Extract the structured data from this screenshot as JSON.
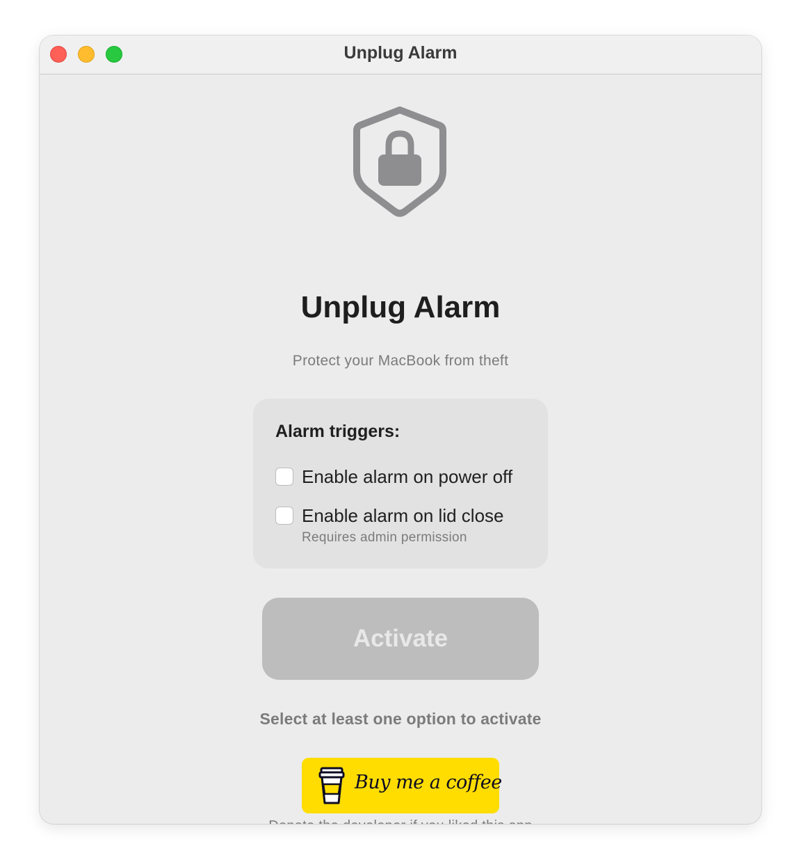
{
  "window": {
    "title": "Unplug Alarm"
  },
  "header": {
    "icon": "shield-lock-icon",
    "app_title": "Unplug Alarm",
    "subtitle": "Protect your MacBook from theft"
  },
  "triggers": {
    "heading": "Alarm triggers:",
    "options": [
      {
        "label": "Enable alarm on power off",
        "checked": false
      },
      {
        "label": "Enable alarm on lid close",
        "checked": false,
        "note": "Requires admin permission"
      }
    ]
  },
  "activate": {
    "label": "Activate",
    "enabled": false
  },
  "hint": "Select at least one option to activate",
  "donate": {
    "icon": "coffee-cup-icon",
    "button_label": "Buy me a coffee",
    "note": "Donate the developer if you liked this app"
  },
  "colors": {
    "traffic_close": "#fe5f57",
    "traffic_minimize": "#febc2e",
    "traffic_zoom": "#28c840",
    "coffee_yellow": "#ffdd00",
    "activate_disabled": "#bdbdbd"
  }
}
